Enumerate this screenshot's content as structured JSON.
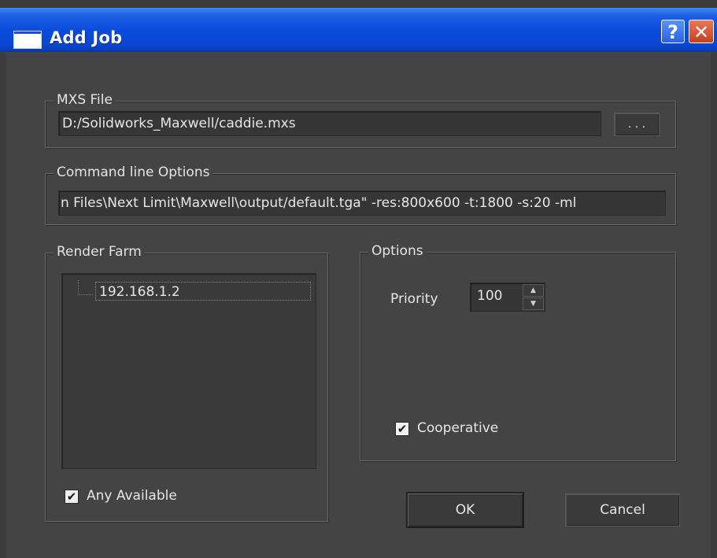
{
  "window": {
    "title": "Add Job",
    "help_glyph": "?",
    "close_glyph": "✕"
  },
  "mxs": {
    "label": "MXS File",
    "value": "D:/Solidworks_Maxwell/caddie.mxs",
    "browse_label": ". . ."
  },
  "cmd": {
    "label": "Command line Options",
    "value": "n Files\\Next Limit\\Maxwell\\output/default.tga\" -res:800x600 -t:1800 -s:20 -ml"
  },
  "farm": {
    "label": "Render Farm",
    "items": [
      "192.168.1.2"
    ],
    "any_available_label": "Any Available",
    "any_available_checked": true
  },
  "options": {
    "label": "Options",
    "priority_label": "Priority",
    "priority_value": "100",
    "cooperative_label": "Cooperative",
    "cooperative_checked": true
  },
  "buttons": {
    "ok": "OK",
    "cancel": "Cancel"
  },
  "check_glyph": "✔"
}
